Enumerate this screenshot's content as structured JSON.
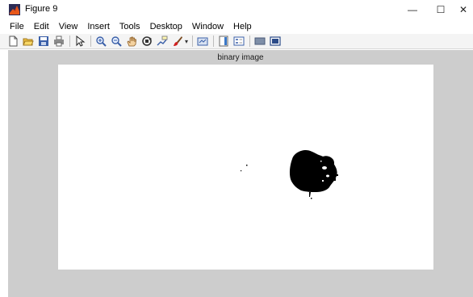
{
  "window": {
    "title": "Figure 9",
    "minimize_symbol": "—",
    "maximize_symbol": "☐",
    "close_symbol": "✕"
  },
  "menubar": {
    "items": [
      "File",
      "Edit",
      "View",
      "Insert",
      "Tools",
      "Desktop",
      "Window",
      "Help"
    ]
  },
  "toolbar": {
    "icons": [
      "new-figure-icon",
      "open-file-icon",
      "save-figure-icon",
      "print-figure-icon",
      "edit-plot-icon",
      "zoom-in-icon",
      "zoom-out-icon",
      "pan-icon",
      "rotate-3d-icon",
      "data-cursor-icon",
      "brush-icon",
      "link-plot-icon",
      "insert-colorbar-icon",
      "insert-legend-icon",
      "hide-plot-tools-icon",
      "show-plot-tools-icon"
    ]
  },
  "figure": {
    "axes_title": "binary image",
    "background_color": "#cdcdcd",
    "axes_background": "#ffffff",
    "blob_color": "#000000"
  }
}
